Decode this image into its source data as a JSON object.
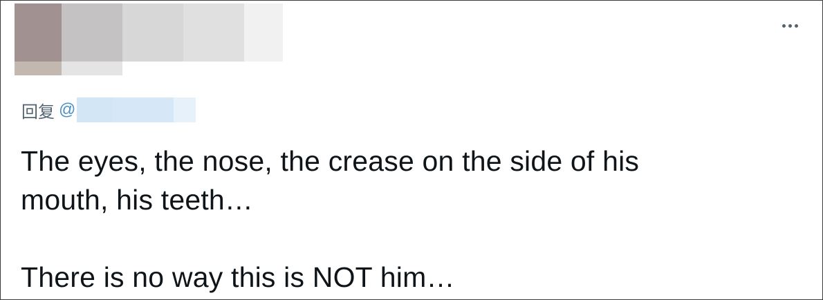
{
  "tweet": {
    "reply_prefix": "回复",
    "reply_at": "@",
    "text_line1": "The eyes, the nose, the crease on the side of his",
    "text_line2": "mouth, his teeth…",
    "text_line3": "There is no way this is NOT him…"
  },
  "icons": {
    "more": "more-horizontal-icon"
  },
  "colors": {
    "text": "#0f1419",
    "secondary": "#536471",
    "link": "#4a90c9",
    "border": "#3a3a3a"
  }
}
